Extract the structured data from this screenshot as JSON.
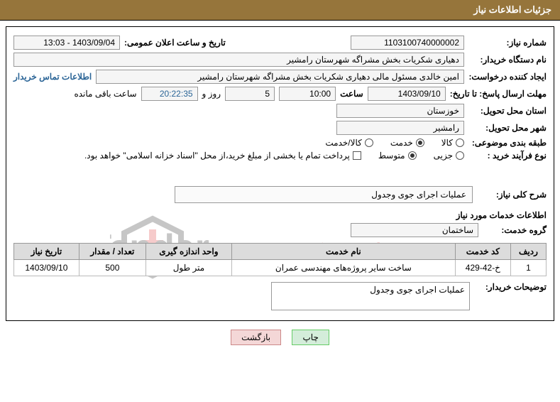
{
  "header": {
    "title": "جزئیات اطلاعات نیاز"
  },
  "fields": {
    "need_number_label": "شماره نیاز:",
    "need_number": "1103100740000002",
    "announce_label": "تاریخ و ساعت اعلان عمومی:",
    "announce_value": "1403/09/04 - 13:03",
    "buyer_org_label": "نام دستگاه خریدار:",
    "buyer_org": "دهیاری شکریات بخش مشراگه شهرستان رامشیر",
    "creator_label": "ایجاد کننده درخواست:",
    "creator": "امین خالدی مسئول مالی دهیاری شکریات بخش مشراگه شهرستان رامشیر",
    "contact_link": "اطلاعات تماس خریدار",
    "deadline_label": "مهلت ارسال پاسخ: تا تاریخ:",
    "deadline_date": "1403/09/10",
    "hour_label": "ساعت",
    "deadline_hour": "10:00",
    "days": "5",
    "days_and": "روز و",
    "time_counter": "20:22:35",
    "remaining": "ساعت باقی مانده",
    "province_label": "استان محل تحویل:",
    "province": "خوزستان",
    "city_label": "شهر محل تحویل:",
    "city": "رامشیر",
    "category_label": "طبقه بندی موضوعی:",
    "cat_goods": "کالا",
    "cat_service": "خدمت",
    "cat_goods_service": "کالا/خدمت",
    "process_label": "نوع فرآیند خرید :",
    "proc_small": "جزیی",
    "proc_medium": "متوسط",
    "payment_note": "پرداخت تمام یا بخشی از مبلغ خرید،از محل \"اسناد خزانه اسلامی\" خواهد بود.",
    "need_summary_label": "شرح کلی نیاز:",
    "need_summary": "عملیات اجرای جوی وجدول",
    "services_info_title": "اطلاعات خدمات مورد نیاز",
    "service_group_label": "گروه خدمت:",
    "service_group": "ساختمان",
    "buyer_notes_label": "توضیحات خریدار:",
    "buyer_notes": "عملیات اجرای جوی وجدول"
  },
  "table": {
    "headers": {
      "row": "ردیف",
      "code": "کد خدمت",
      "name": "نام خدمت",
      "unit": "واحد اندازه گیری",
      "qty": "تعداد / مقدار",
      "need_date": "تاریخ نیاز"
    },
    "rows": [
      {
        "row": "1",
        "code": "خ-42-429",
        "name": "ساخت سایر پروژه‌های مهندسی عمران",
        "unit": "متر طول",
        "qty": "500",
        "need_date": "1403/09/10"
      }
    ]
  },
  "buttons": {
    "print": "چاپ",
    "back": "بازگشت"
  },
  "watermark": {
    "text": "AriaTender.net"
  }
}
